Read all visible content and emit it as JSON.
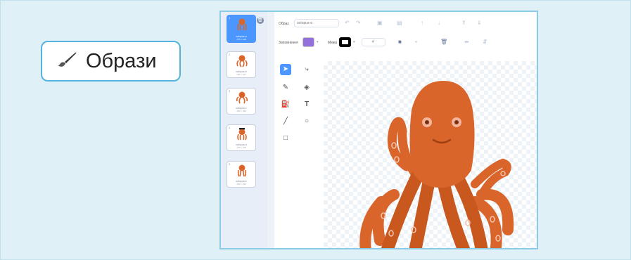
{
  "tab": {
    "label": "Образи",
    "icon": "brush-icon",
    "border_color": "#55b4dd"
  },
  "costumes": [
    {
      "number": "1",
      "name": "octopus-a",
      "size": "175 × 148",
      "selected": true
    },
    {
      "number": "2",
      "name": "octopus-b",
      "size": "140 × 147",
      "selected": false
    },
    {
      "number": "3",
      "name": "octopus-c",
      "size": "150 × 150",
      "selected": false
    },
    {
      "number": "4",
      "name": "octopus-d",
      "size": "175 × 148",
      "selected": false
    },
    {
      "number": "5",
      "name": "octopus-e",
      "size": "150 × 150",
      "selected": false
    }
  ],
  "editor": {
    "costume_label": "Образ",
    "costume_name": "octopus-a",
    "fill_label": "Заповнення",
    "outline_label": "Межа",
    "outline_width": "4",
    "fill_color": "#9370db",
    "outline_color": "#000000",
    "accent_color": "#4c97ff",
    "octopus_color": "#d9652a"
  }
}
